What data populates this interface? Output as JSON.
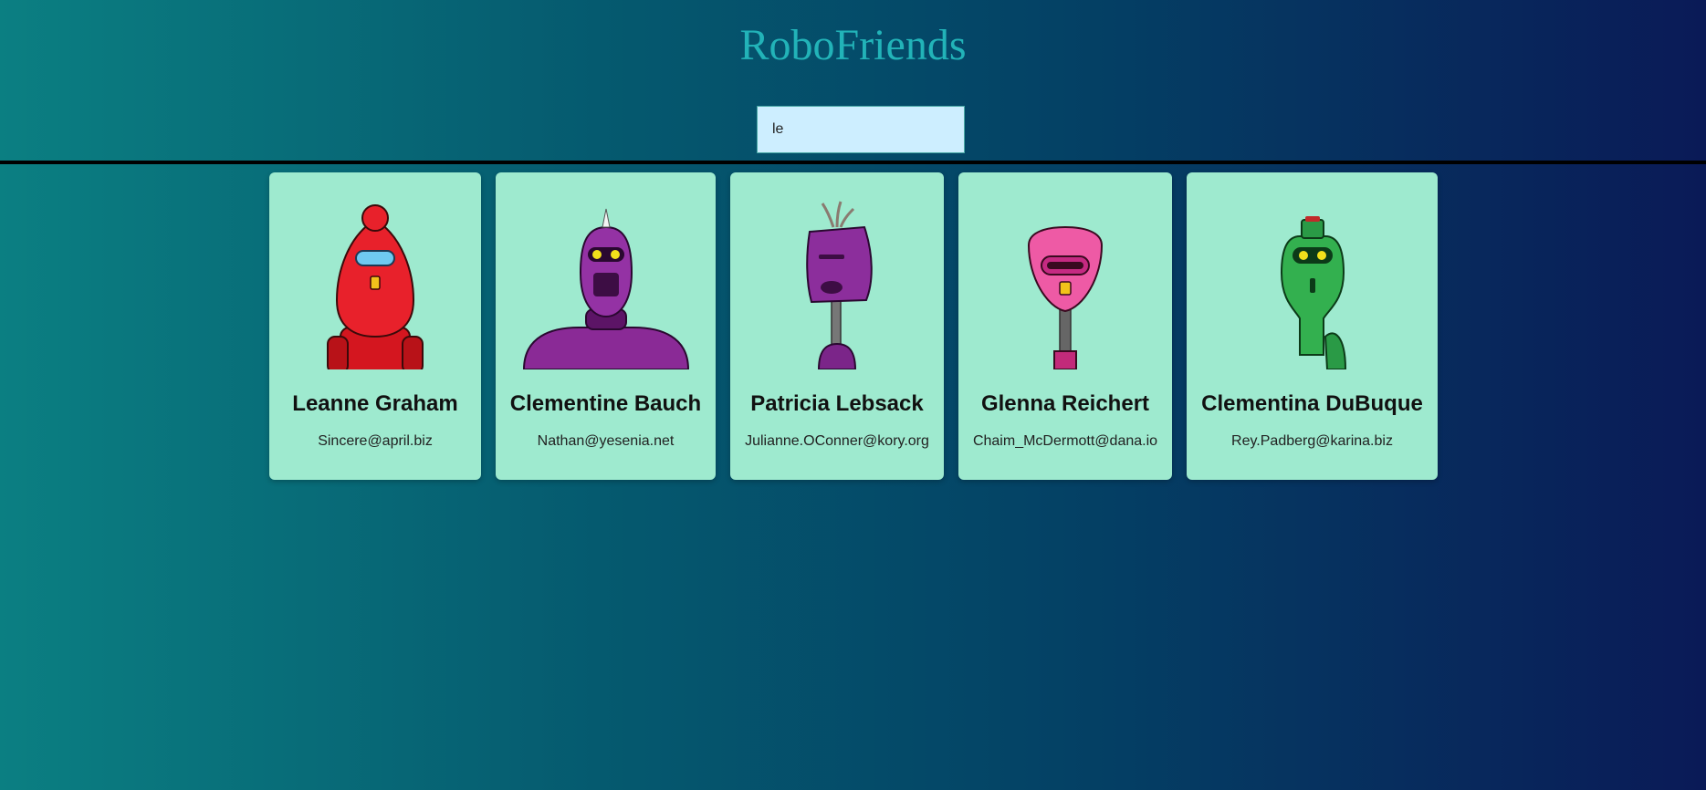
{
  "app": {
    "title": "RoboFriends"
  },
  "search": {
    "value": "le"
  },
  "robots": [
    {
      "name": "Leanne Graham",
      "email": "Sincere@april.biz",
      "color": "#e0202a"
    },
    {
      "name": "Clementine Bauch",
      "email": "Nathan@yesenia.net",
      "color": "#8a2a96"
    },
    {
      "name": "Patricia Lebsack",
      "email": "Julianne.OConner@kory.org",
      "color": "#7b2589"
    },
    {
      "name": "Glenna Reichert",
      "email": "Chaim_McDermott@dana.io",
      "color": "#ef5aa6"
    },
    {
      "name": "Clementina DuBuque",
      "email": "Rey.Padberg@karina.biz",
      "color": "#2aa84a"
    }
  ],
  "colors": {
    "card": "#9eeacf",
    "title": "#22b3b8",
    "search_bg": "#cdeeff"
  }
}
